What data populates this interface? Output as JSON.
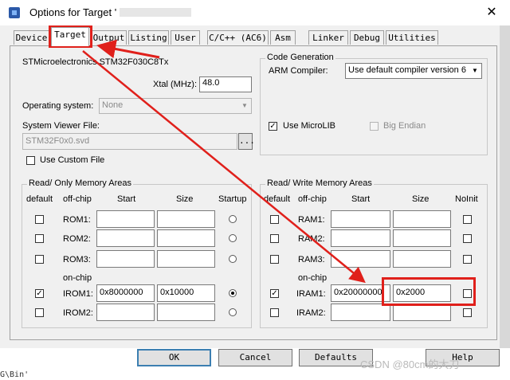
{
  "window": {
    "title": "Options for Target '",
    "close_label": "✕"
  },
  "tabs": [
    {
      "label": "Device"
    },
    {
      "label": "Target"
    },
    {
      "label": "Output"
    },
    {
      "label": "Listing"
    },
    {
      "label": "User"
    },
    {
      "label": "C/C++ (AC6)"
    },
    {
      "label": "Asm"
    },
    {
      "label": "Linker"
    },
    {
      "label": "Debug"
    },
    {
      "label": "Utilities"
    }
  ],
  "target": {
    "device_name": "STMicroelectronics STM32F030C8Tx",
    "xtal_label": "Xtal (MHz):",
    "xtal_value": "48.0",
    "os_label": "Operating system:",
    "os_value": "None",
    "svd_label": "System Viewer File:",
    "svd_value": "STM32F0x0.svd",
    "browse_label": "...",
    "use_custom_file_label": "Use Custom File"
  },
  "code_generation": {
    "title": "Code Generation",
    "compiler_label": "ARM Compiler:",
    "compiler_value": "Use default compiler version 6",
    "use_microlib_label": "Use MicroLIB",
    "big_endian_label": "Big Endian"
  },
  "ro_memory": {
    "title": "Read/ Only Memory Areas",
    "headers": {
      "default": "default",
      "offchip": "off-chip",
      "start": "Start",
      "size": "Size",
      "startup": "Startup"
    },
    "onchip_label": "on-chip",
    "rows": [
      {
        "name": "ROM1:",
        "start": "",
        "size": "",
        "default": false,
        "startup": false
      },
      {
        "name": "ROM2:",
        "start": "",
        "size": "",
        "default": false,
        "startup": false
      },
      {
        "name": "ROM3:",
        "start": "",
        "size": "",
        "default": false,
        "startup": false
      },
      {
        "name": "IROM1:",
        "start": "0x8000000",
        "size": "0x10000",
        "default": true,
        "startup": true
      },
      {
        "name": "IROM2:",
        "start": "",
        "size": "",
        "default": false,
        "startup": false
      }
    ]
  },
  "rw_memory": {
    "title": "Read/ Write Memory Areas",
    "headers": {
      "default": "default",
      "offchip": "off-chip",
      "start": "Start",
      "size": "Size",
      "noinit": "NoInit"
    },
    "onchip_label": "on-chip",
    "rows": [
      {
        "name": "RAM1:",
        "start": "",
        "size": "",
        "default": false
      },
      {
        "name": "RAM2:",
        "start": "",
        "size": "",
        "default": false
      },
      {
        "name": "RAM3:",
        "start": "",
        "size": "",
        "default": false
      },
      {
        "name": "IRAM1:",
        "start": "0x20000000",
        "size": "0x2000",
        "default": true
      },
      {
        "name": "IRAM2:",
        "start": "",
        "size": "",
        "default": false
      }
    ]
  },
  "buttons": {
    "ok": "OK",
    "cancel": "Cancel",
    "defaults": "Defaults",
    "help": "Help"
  },
  "background": {
    "console_text": "G\\Bin'",
    "watermark": "CSDN @80cm的大刀"
  },
  "colors": {
    "annotation_red": "#e0201b",
    "default_button_border": "#3c7fb1"
  }
}
